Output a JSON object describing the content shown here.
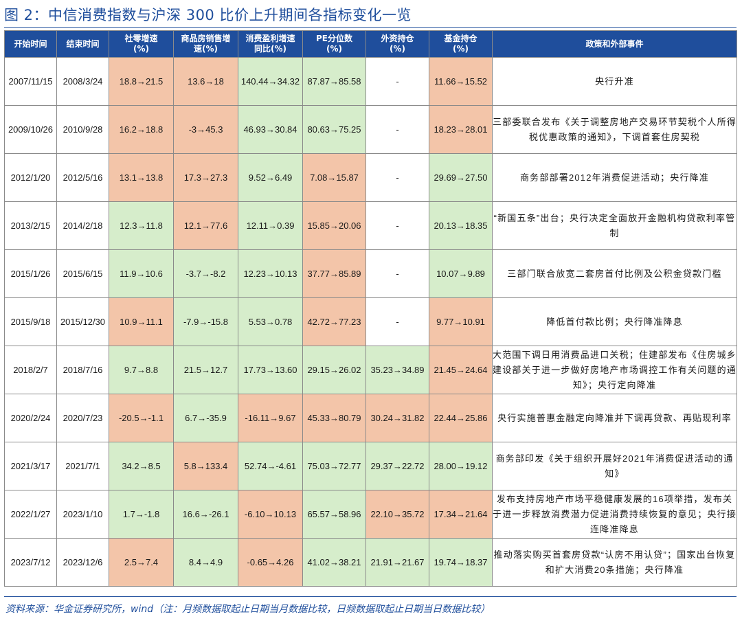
{
  "title": "图 2：中信消费指数与沪深 300 比价上升期间各指标变化一览",
  "headers": [
    "开始时间",
    "结束时间",
    "社零增速\n(%)",
    "商品房销售增\n速(%)",
    "消费盈利增速\n同比(%)",
    "PE分位数\n(%)",
    "外资持仓\n(%)",
    "基金持仓\n(%)",
    "政策和外部事件"
  ],
  "colors": {
    "header": "#1f4e9c",
    "orange": "#f3c5a9",
    "green": "#d6edcb"
  },
  "rows": [
    {
      "start": "2007/11/15",
      "end": "2008/3/24",
      "retail": "18.8→21.5",
      "house": "13.6→18",
      "profit": "140.44→34.32",
      "pe": "87.87→85.58",
      "foreign": "-",
      "fund": "11.66→15.52",
      "events": "央行升准",
      "colors": [
        "or",
        "or",
        "gr",
        "gr",
        "",
        "or"
      ]
    },
    {
      "start": "2009/10/26",
      "end": "2010/9/28",
      "retail": "16.2→18.8",
      "house": "-3→45.3",
      "profit": "46.93→30.84",
      "pe": "80.63→75.25",
      "foreign": "-",
      "fund": "18.23→28.01",
      "events": "三部委联合发布《关于调整房地产交易环节契税个人所得税优惠政策的通知》，下调首套住房契税",
      "colors": [
        "or",
        "or",
        "gr",
        "gr",
        "",
        "or"
      ]
    },
    {
      "start": "2012/1/20",
      "end": "2012/5/16",
      "retail": "13.1→13.8",
      "house": "17.3→27.3",
      "profit": "9.52→6.49",
      "pe": "7.08→15.87",
      "foreign": "-",
      "fund": "29.69→27.50",
      "events": "商务部部署2012年消费促进活动；央行降准",
      "colors": [
        "or",
        "or",
        "gr",
        "or",
        "",
        "gr"
      ]
    },
    {
      "start": "2013/2/15",
      "end": "2014/2/18",
      "retail": "12.3→11.8",
      "house": "12.1→77.6",
      "profit": "12.11→0.39",
      "pe": "15.85→20.06",
      "foreign": "-",
      "fund": "20.13→18.35",
      "events": "“新国五条”出台；央行决定全面放开金融机构贷款利率管制",
      "colors": [
        "gr",
        "or",
        "gr",
        "or",
        "",
        "gr"
      ]
    },
    {
      "start": "2015/1/26",
      "end": "2015/6/15",
      "retail": "11.9→10.6",
      "house": "-3.7→-8.2",
      "profit": "12.23→10.13",
      "pe": "37.77→85.89",
      "foreign": "-",
      "fund": "10.07→9.89",
      "events": "三部门联合放宽二套房首付比例及公积金贷款门槛",
      "colors": [
        "gr",
        "gr",
        "gr",
        "or",
        "",
        "gr"
      ]
    },
    {
      "start": "2015/9/18",
      "end": "2015/12/30",
      "retail": "10.9→11.1",
      "house": "-7.9→-15.8",
      "profit": "5.53→0.78",
      "pe": "42.72→77.23",
      "foreign": "-",
      "fund": "9.77→10.91",
      "events": "降低首付款比例；央行降准降息",
      "colors": [
        "or",
        "gr",
        "gr",
        "or",
        "",
        "or"
      ]
    },
    {
      "start": "2018/2/7",
      "end": "2018/7/16",
      "retail": "9.7→8.8",
      "house": "21.5→12.7",
      "profit": "17.73→13.60",
      "pe": "29.15→26.02",
      "foreign": "35.23→34.89",
      "fund": "21.45→24.64",
      "events": "大范围下调日用消费品进口关税；住建部发布《住房城乡建设部关于进一步做好房地产市场调控工作有关问题的通知》；央行定向降准",
      "colors": [
        "gr",
        "gr",
        "gr",
        "gr",
        "gr",
        "or"
      ]
    },
    {
      "start": "2020/2/24",
      "end": "2020/7/23",
      "retail": "-20.5→-1.1",
      "house": "6.7→-35.9",
      "profit": "-16.11→9.67",
      "pe": "45.33→80.79",
      "foreign": "30.24→31.82",
      "fund": "22.44→25.86",
      "events": "央行实施普惠金融定向降准并下调再贷款、再贴现利率",
      "colors": [
        "or",
        "gr",
        "or",
        "or",
        "or",
        "or"
      ]
    },
    {
      "start": "2021/3/17",
      "end": "2021/7/1",
      "retail": "34.2→8.5",
      "house": "5.8→133.4",
      "profit": "52.74→-4.61",
      "pe": "75.03→72.77",
      "foreign": "29.37→22.72",
      "fund": "28.00→19.12",
      "events": "商务部印发《关于组织开展好2021年消费促进活动的通知》",
      "colors": [
        "gr",
        "or",
        "gr",
        "gr",
        "gr",
        "gr"
      ]
    },
    {
      "start": "2022/1/27",
      "end": "2023/1/10",
      "retail": "1.7→-1.8",
      "house": "16.6→-26.1",
      "profit": "-6.10→10.13",
      "pe": "65.57→58.96",
      "foreign": "22.10→35.72",
      "fund": "17.34→21.64",
      "events": "发布支持房地产市场平稳健康发展的16项举措，发布关于进一步释放消费潜力促进消费持续恢复的意见；央行接连降准降息",
      "colors": [
        "gr",
        "gr",
        "or",
        "gr",
        "or",
        "or"
      ]
    },
    {
      "start": "2023/7/12",
      "end": "2023/12/6",
      "retail": "2.5→7.4",
      "house": "8.4→4.9",
      "profit": "-0.65→4.26",
      "pe": "41.02→38.21",
      "foreign": "21.91→21.67",
      "fund": "19.74→18.37",
      "events": "推动落实购买首套房贷款“认房不用认贷”；国家出台恢复和扩大消费20条措施；央行降准",
      "colors": [
        "or",
        "gr",
        "or",
        "gr",
        "gr",
        "gr"
      ]
    }
  ],
  "footer": "资料来源：华金证券研究所，wind（注：月频数据取起止日期当月数据比较，日频数据取起止日期当日数据比较）"
}
